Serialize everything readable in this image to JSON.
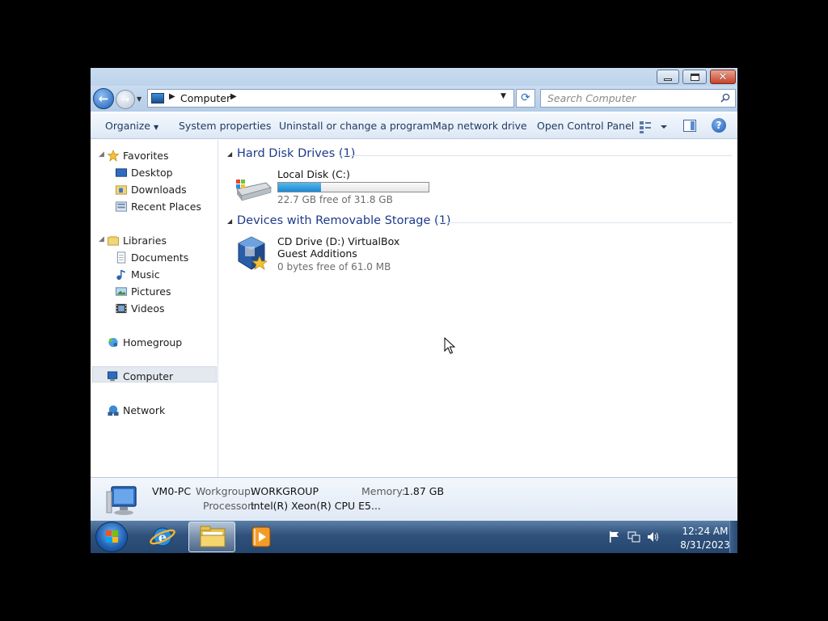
{
  "window": {
    "title_buttons": {
      "minimize": "minimize",
      "maximize": "maximize",
      "close": "close"
    }
  },
  "nav": {
    "breadcrumb": [
      "Computer"
    ],
    "search_placeholder": "Search Computer"
  },
  "toolbar": {
    "organize": "Organize",
    "system_properties": "System properties",
    "uninstall": "Uninstall or change a program",
    "map_drive": "Map network drive",
    "control_panel": "Open Control Panel"
  },
  "sidebar": {
    "favorites": {
      "label": "Favorites",
      "items": [
        "Desktop",
        "Downloads",
        "Recent Places"
      ]
    },
    "libraries": {
      "label": "Libraries",
      "items": [
        "Documents",
        "Music",
        "Pictures",
        "Videos"
      ]
    },
    "homegroup": "Homegroup",
    "computer": "Computer",
    "network": "Network"
  },
  "groups": {
    "hdd": {
      "header": "Hard Disk Drives (1)",
      "drive": {
        "name": "Local Disk (C:)",
        "free_text": "22.7 GB free of 31.8 GB",
        "used_fraction": 0.286
      }
    },
    "removable": {
      "header": "Devices with Removable Storage (1)",
      "drive": {
        "name": "CD Drive (D:) VirtualBox Guest Additions",
        "free_text": "0 bytes free of 61.0 MB"
      }
    }
  },
  "details": {
    "name": "VM0-PC",
    "workgroup_label": "Workgroup:",
    "workgroup": "WORKGROUP",
    "memory_label": "Memory:",
    "memory": "1.87 GB",
    "processor_label": "Processor:",
    "processor": "Intel(R) Xeon(R) CPU E5..."
  },
  "taskbar": {
    "clock_time": "12:24 AM",
    "clock_date": "8/31/2023"
  },
  "colors": {
    "accent": "#1e3a8a",
    "progress": "#1a8ad4"
  }
}
